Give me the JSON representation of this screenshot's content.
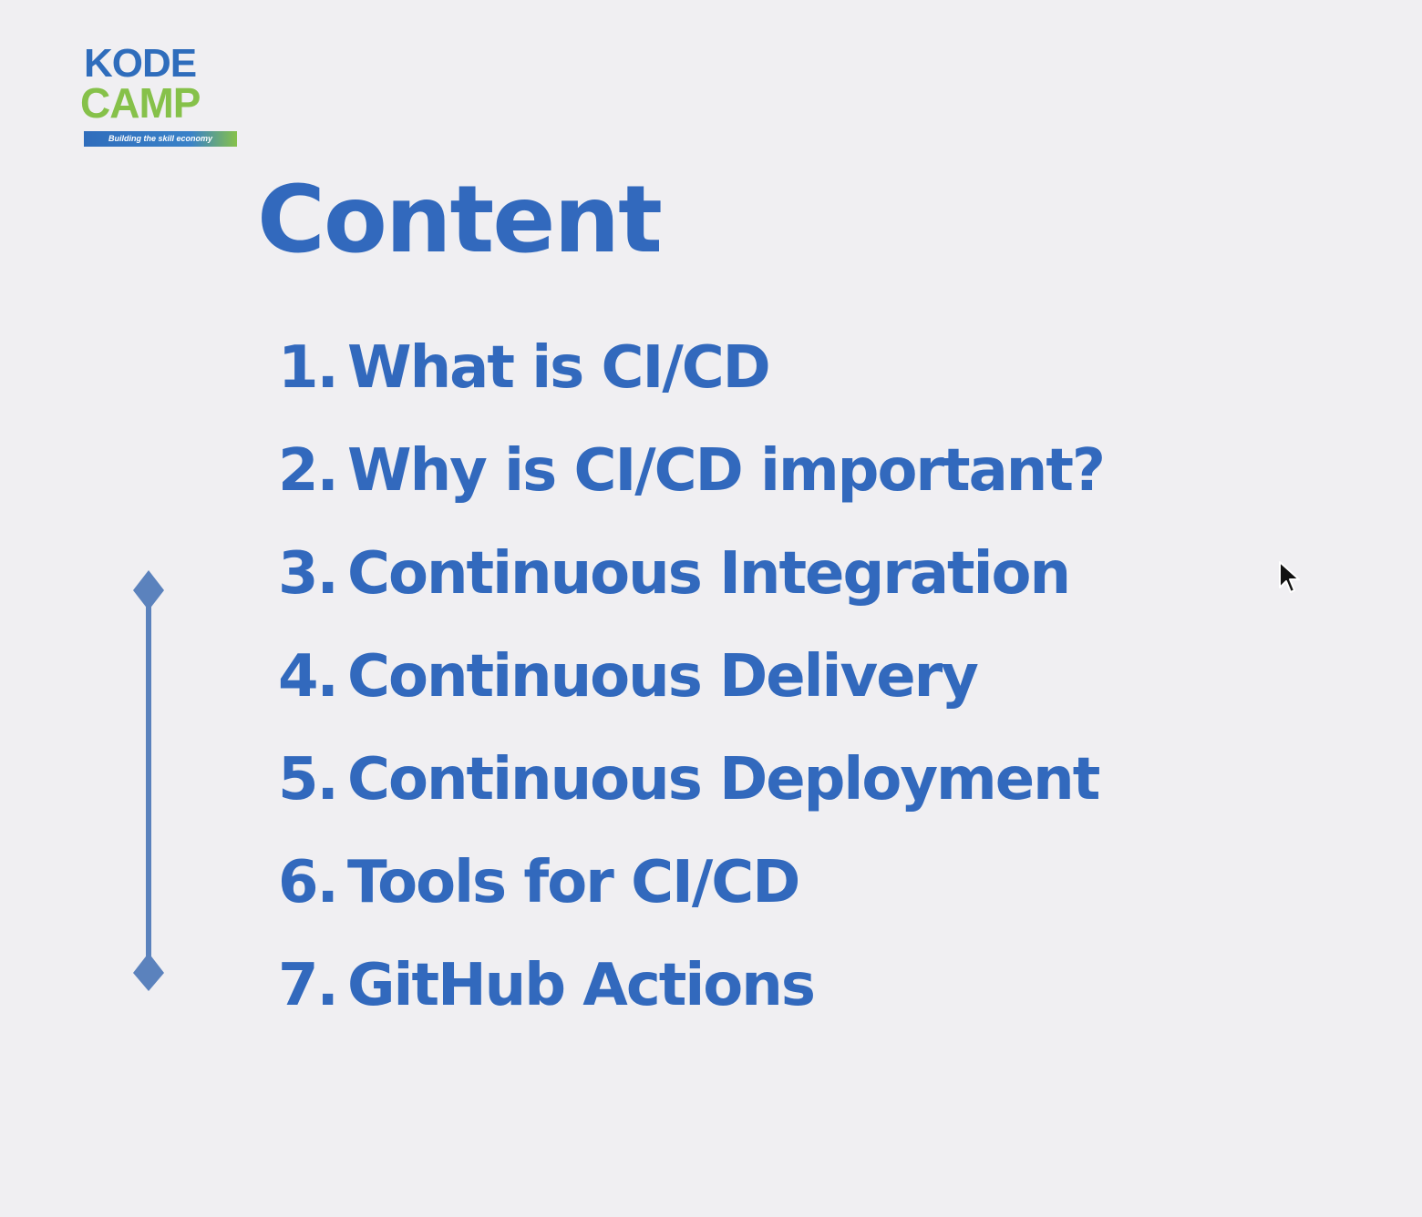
{
  "logo": {
    "line1": "KODE",
    "line2": "CAMP",
    "tagline": "Building the skill economy"
  },
  "slide": {
    "title": "Content",
    "items": [
      {
        "num": "1.",
        "text": "What is CI/CD"
      },
      {
        "num": "2.",
        "text": "Why is CI/CD important?"
      },
      {
        "num": "3.",
        "text": "Continuous Integration"
      },
      {
        "num": "4.",
        "text": "Continuous Delivery"
      },
      {
        "num": "5.",
        "text": "Continuous Deployment"
      },
      {
        "num": "6.",
        "text": "Tools for CI/CD"
      },
      {
        "num": "7.",
        "text": "GitHub Actions"
      }
    ]
  },
  "colors": {
    "text": "#3269bd",
    "background": "#f0eff2",
    "logo_blue": "#2f6dbc",
    "logo_green": "#86c14a",
    "decoration": "#5b82bd"
  },
  "icons": {
    "cursor": "mouse-pointer-icon",
    "decoration": "vertical-diamond-line"
  }
}
